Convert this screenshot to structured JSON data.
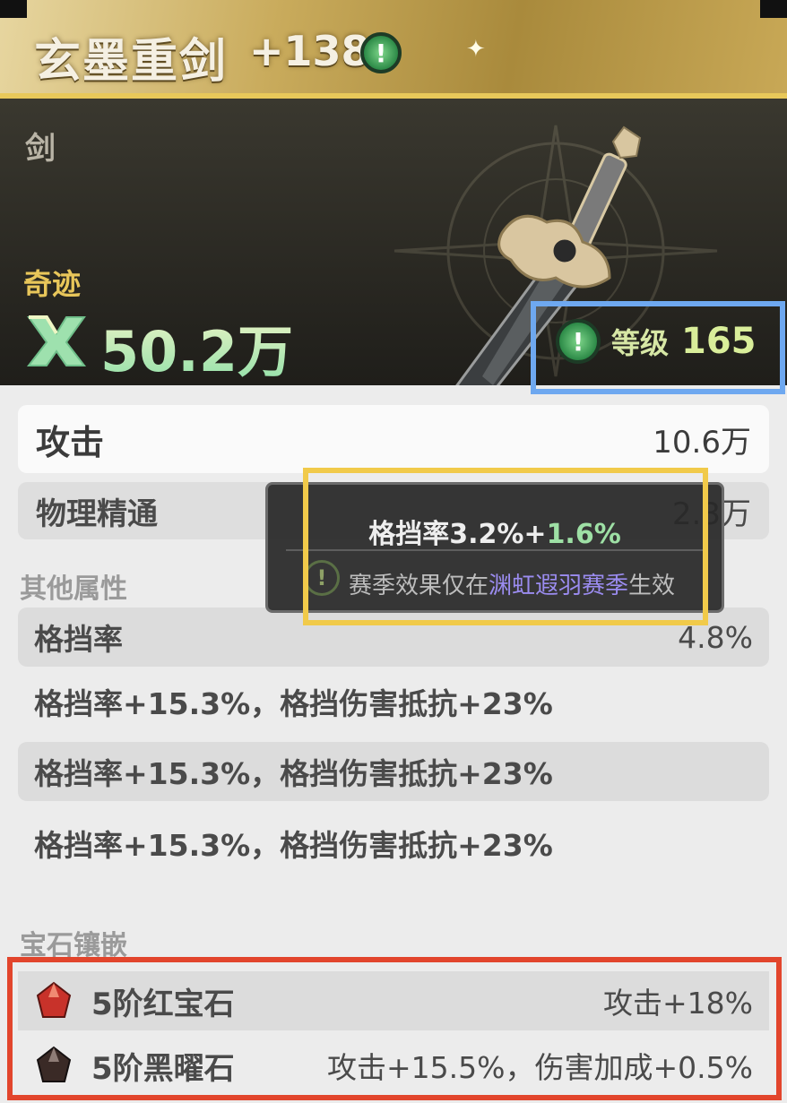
{
  "item": {
    "name": "玄墨重剑",
    "refine": "+138",
    "type": "剑",
    "rarity": "奇迹",
    "power": "50.2万",
    "level_label": "等级",
    "level": "165"
  },
  "stats": {
    "main": {
      "label": "攻击",
      "value": "10.6万"
    },
    "sub": {
      "label": "物理精通",
      "value": "2.3万"
    }
  },
  "tooltip": {
    "stat": "格挡率3.2%+",
    "bonus": "1.6%",
    "note_prefix": "赛季效果仅在",
    "note_season": "渊虹遐羽赛季",
    "note_suffix": "生效"
  },
  "other_attrs": {
    "title": "其他属性",
    "rows": [
      {
        "label": "格挡率",
        "value": "4.8%"
      },
      {
        "label": "格挡率+15.3%，格挡伤害抵抗+23%",
        "value": ""
      },
      {
        "label": "格挡率+15.3%，格挡伤害抵抗+23%",
        "value": ""
      },
      {
        "label": "格挡率+15.3%，格挡伤害抵抗+23%",
        "value": ""
      }
    ]
  },
  "gems": {
    "title": "宝石镶嵌",
    "items": [
      {
        "name": "5阶红宝石",
        "effect": "攻击+18%",
        "icon": "red-gem-icon",
        "color": "#c8322a"
      },
      {
        "name": "5阶黑曜石",
        "effect": "攻击+15.5%，伤害加成+0.5%",
        "icon": "obsidian-gem-icon",
        "color": "#3a2a26"
      }
    ]
  }
}
